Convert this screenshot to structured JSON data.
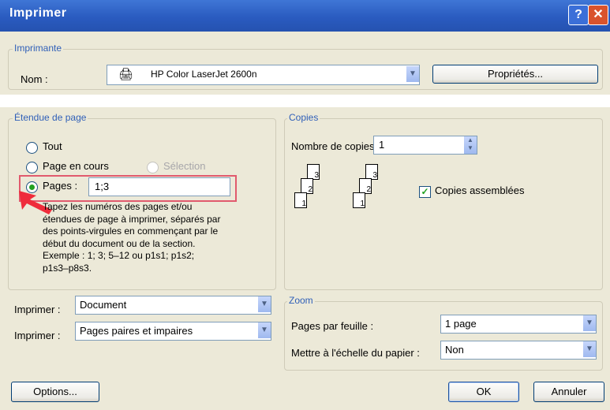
{
  "title": "Imprimer",
  "title_buttons": {
    "help": "?",
    "close": "✕"
  },
  "printer": {
    "group_label": "Imprimante",
    "name_label": "Nom :",
    "name_value": "HP Color LaserJet 2600n",
    "properties_button": "Propriétés..."
  },
  "range": {
    "group_label": "Étendue de page",
    "all_label": "Tout",
    "current_label": "Page en cours",
    "selection_label": "Sélection",
    "pages_label": "Pages :",
    "pages_value": "1;3",
    "help_lines": [
      "Tapez les numéros des pages et/ou",
      "étendues de page à imprimer, séparés par",
      "des points-virgules en commençant par le",
      "début du document ou de la section.",
      "Exemple : 1; 3; 5–12 ou p1s1; p1s2;",
      "p1s3–p8s3."
    ]
  },
  "copies": {
    "group_label": "Copies",
    "number_label": "Nombre de copies :",
    "number_value": "1",
    "collate_label": "Copies assemblées",
    "collate_checked": true,
    "page_numbers": [
      "3",
      "2",
      "1"
    ]
  },
  "print_what": {
    "label": "Imprimer :",
    "value": "Document"
  },
  "print_pages": {
    "label": "Imprimer :",
    "value": "Pages paires et impaires"
  },
  "zoom": {
    "group_label": "Zoom",
    "pages_per_sheet_label": "Pages par feuille :",
    "pages_per_sheet_value": "1 page",
    "scale_label": "Mettre à l'échelle du papier :",
    "scale_value": "Non"
  },
  "buttons": {
    "options": "Options...",
    "ok": "OK",
    "cancel": "Annuler"
  }
}
